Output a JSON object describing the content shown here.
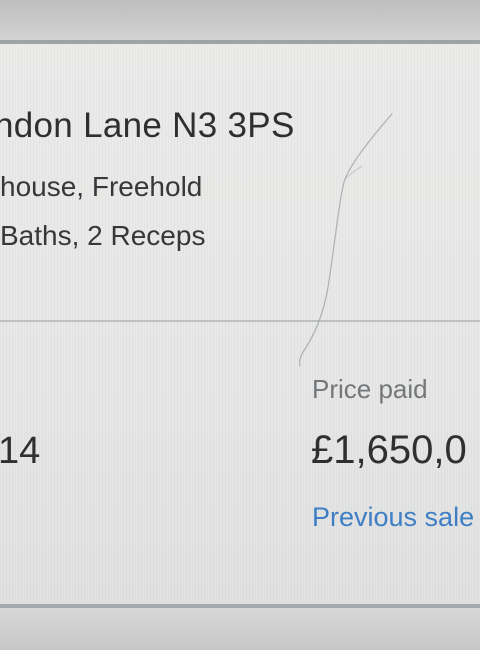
{
  "listing": {
    "address": "ndon Lane N3 3PS",
    "property_type": "house, Freehold",
    "rooms": "Baths, 2 Receps"
  },
  "sale": {
    "date_partial": "14",
    "price_label": "Price paid",
    "price_value": "£1,650,0",
    "previous_sales_link": "Previous sale"
  },
  "colors": {
    "link": "#3f7fc6",
    "text_primary": "#2e2f31",
    "text_secondary": "#75787b",
    "divider": "#bfc3c6"
  }
}
